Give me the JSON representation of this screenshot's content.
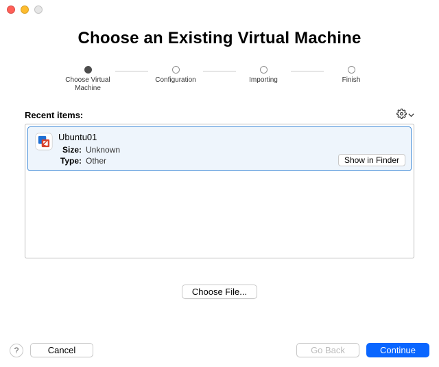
{
  "heading": "Choose an Existing Virtual Machine",
  "stepper": {
    "steps": [
      {
        "label": "Choose Virtual\nMachine",
        "active": true
      },
      {
        "label": "Configuration",
        "active": false
      },
      {
        "label": "Importing",
        "active": false
      },
      {
        "label": "Finish",
        "active": false
      }
    ]
  },
  "recent": {
    "heading": "Recent items:",
    "items": [
      {
        "name": "Ubuntu01",
        "size_label": "Size:",
        "size_value": "Unknown",
        "type_label": "Type:",
        "type_value": "Other",
        "show_in_finder_label": "Show in Finder"
      }
    ]
  },
  "buttons": {
    "choose_file": "Choose File...",
    "help": "?",
    "cancel": "Cancel",
    "go_back": "Go Back",
    "continue": "Continue"
  },
  "icons": {
    "gear": "gear-icon",
    "chevron_down": "chevron-down-icon",
    "vm": "vmware-app-icon"
  },
  "colors": {
    "accent": "#0a66ff",
    "selection_bg": "#eef5fc",
    "selection_border": "#4a90d9"
  }
}
